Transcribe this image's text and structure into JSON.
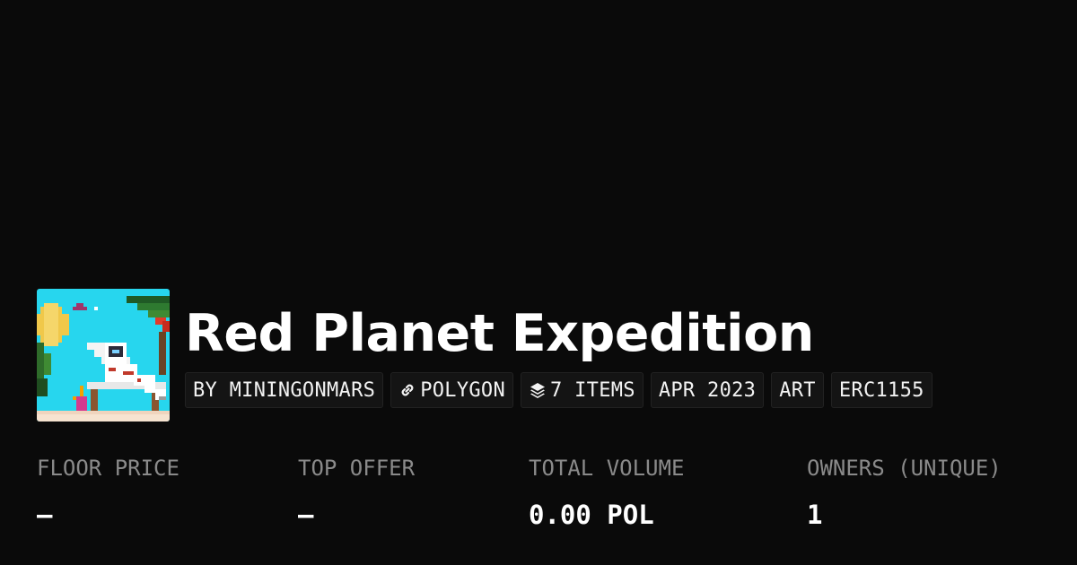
{
  "collection": {
    "title": "Red Planet Expedition",
    "avatar_alt": "pixel-art astronaut on a beach"
  },
  "tags": [
    {
      "label": "BY MININGONMARS",
      "icon": ""
    },
    {
      "label": "POLYGON",
      "icon": "link-icon"
    },
    {
      "label": "7 ITEMS",
      "icon": "layers-icon"
    },
    {
      "label": "APR 2023",
      "icon": ""
    },
    {
      "label": "ART",
      "icon": ""
    },
    {
      "label": "ERC1155",
      "icon": ""
    }
  ],
  "stats": [
    {
      "label": "FLOOR PRICE",
      "value": "–"
    },
    {
      "label": "TOP OFFER",
      "value": "–"
    },
    {
      "label": "TOTAL VOLUME",
      "value": "0.00 POL"
    },
    {
      "label": "OWNERS (UNIQUE)",
      "value": "1"
    }
  ],
  "colors": {
    "background": "#0a0a0a",
    "text_primary": "#ffffff",
    "text_muted": "#8a8a8a",
    "tag_background": "#141414"
  }
}
